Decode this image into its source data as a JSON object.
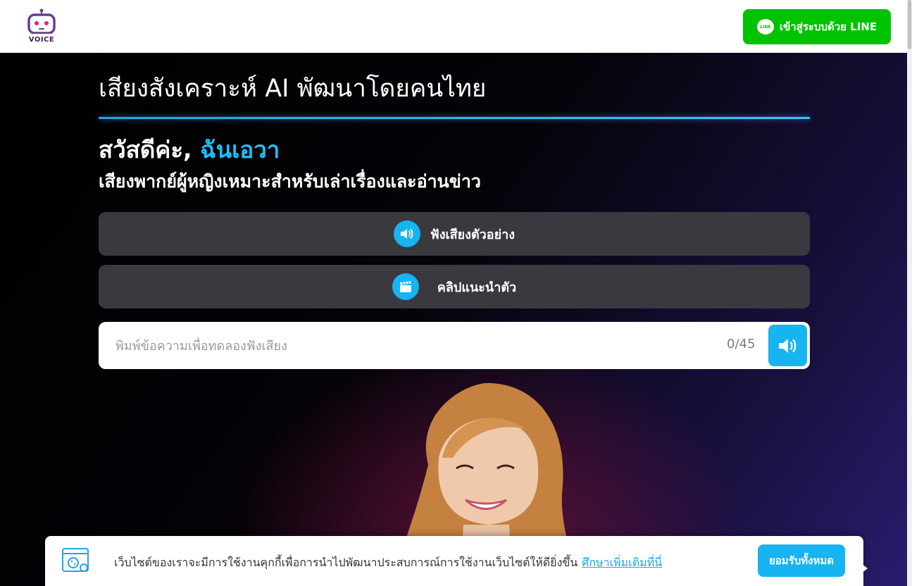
{
  "header": {
    "logo_text": "VOICE",
    "line_login_label": "เข้าสู่ระบบด้วย LINE",
    "line_icon_text": "LINE"
  },
  "hero": {
    "title": "เสียงสังเคราะห์ AI พัฒนาโดยคนไทย",
    "greeting_prefix": "สวัสดีค่ะ,",
    "greeting_name": "ฉันเอวา",
    "description": "เสียงพากย์ผู้หญิงเหมาะสำหรับเล่าเรื่องและอ่านข่าว",
    "listen_sample_label": "ฟังเสียงตัวอย่าง",
    "intro_clip_label": "คลิปแนะนำตัว"
  },
  "tts": {
    "placeholder": "พิมพ์ข้อความเพื่อทดลองฟังเสียง",
    "value": "",
    "counter": "0/45"
  },
  "cookie_banner": {
    "text": "เว็บไซต์ของเราจะมีการใช้งานคุกกี้เพื่อการนำไปพัฒนาประสบการณ์การใช้งานเว็บไซต์ให้ดียิ่งขึ้น",
    "learn_more": "ศึกษาเพิ่มเติมที่นี่",
    "accept_label": "ยอมรับทั้งหมด"
  },
  "colors": {
    "accent": "#16b4f0",
    "line_green": "#00c300",
    "button_bg": "#3a3940"
  }
}
